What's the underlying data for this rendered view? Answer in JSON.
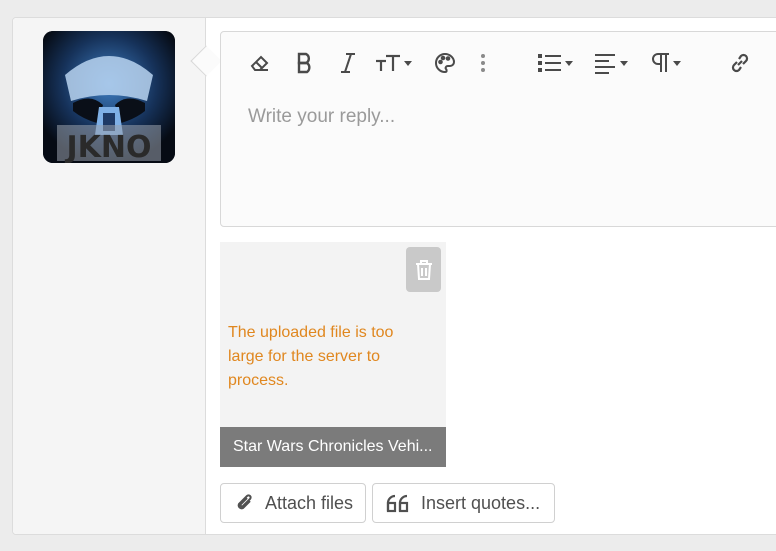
{
  "avatar": {
    "label": "JKNO"
  },
  "editor": {
    "placeholder": "Write your reply...",
    "toolbar": [
      {
        "icon": "eraser-icon"
      },
      {
        "icon": "bold-icon"
      },
      {
        "icon": "italic-icon"
      },
      {
        "icon": "text-size-icon"
      },
      {
        "icon": "palette-icon"
      },
      {
        "icon": "more-icon"
      },
      {
        "icon": "list-icon"
      },
      {
        "icon": "align-icon"
      },
      {
        "icon": "paragraph-icon"
      },
      {
        "icon": "link-icon"
      }
    ]
  },
  "attachment": {
    "error": "The uploaded file is too large for the server to process.",
    "file_name": "Star Wars Chronicles Vehi..."
  },
  "actions": {
    "attach_label": "Attach files",
    "quotes_label": "Insert quotes..."
  },
  "colors": {
    "error": "#e0871f",
    "file_bar": "#7b7b7b"
  }
}
